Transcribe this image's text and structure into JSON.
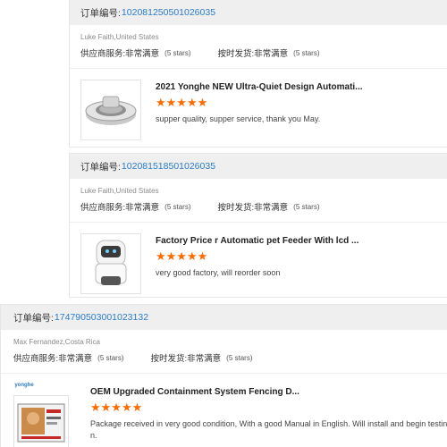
{
  "labels": {
    "order_no": "订单编号:",
    "supplier_service": "供应商服务:",
    "on_time_shipping": "按时发货:",
    "very_satisfied": "非常满意",
    "five_stars": "(5 stars)"
  },
  "orders": [
    {
      "order_id": "102081250501026035",
      "buyer": "Luke Faith,United States",
      "product_title": "2021 Yonghe NEW Ultra-Quiet Design Automati...",
      "stars": "★★★★★",
      "review": "supper quality, supper service, thank you May."
    },
    {
      "order_id": "102081518501026035",
      "buyer": "Luke Faith,United States",
      "product_title": "Factory Price r Automatic pet Feeder With lcd ...",
      "stars": "★★★★★",
      "review": "very good factory, will reorder soon"
    },
    {
      "order_id": "174790503001023132",
      "buyer": "Max Fernandez,Costa Rica",
      "product_title": "OEM Upgraded Containment System Fencing D...",
      "stars": "★★★★★",
      "review": "Package received in very good condition, With a good Manual in English. Will install and begin testing.",
      "review_cont": "n.",
      "logo_text": "yonghe"
    }
  ],
  "colors": {
    "order_link": "#2b7cc7",
    "star": "#ff6a00",
    "header_bg": "#efefef"
  }
}
